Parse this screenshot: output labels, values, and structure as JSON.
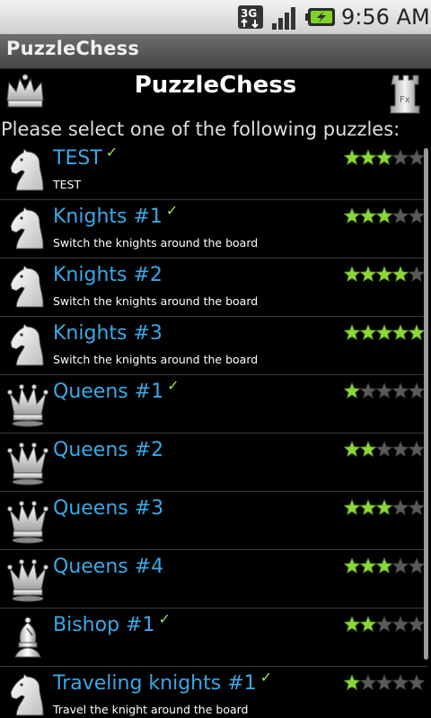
{
  "status_bar": {
    "time": "9:56 AM",
    "network": "3G"
  },
  "title_bar": {
    "title": "PuzzleChess"
  },
  "header": {
    "title": "PuzzleChess"
  },
  "prompt": "Please select one of the following puzzles:",
  "colors": {
    "link": "#3aa9e6",
    "star_on": "#8fd63a",
    "star_off": "#5a5a5a",
    "check": "#9fe05a"
  },
  "puzzles": [
    {
      "title": "TEST",
      "subtitle": "TEST",
      "stars": 3,
      "solved": true,
      "piece": "knight-icon"
    },
    {
      "title": "Knights #1",
      "subtitle": "Switch the knights around the board",
      "stars": 3,
      "solved": true,
      "piece": "knight-icon"
    },
    {
      "title": "Knights #2",
      "subtitle": "Switch the knights around the board",
      "stars": 4,
      "solved": false,
      "piece": "knight-icon"
    },
    {
      "title": "Knights #3",
      "subtitle": "Switch the knights around the board",
      "stars": 5,
      "solved": false,
      "piece": "knight-icon"
    },
    {
      "title": "Queens #1",
      "subtitle": "",
      "stars": 1,
      "solved": true,
      "piece": "queen-icon"
    },
    {
      "title": "Queens #2",
      "subtitle": "",
      "stars": 2,
      "solved": false,
      "piece": "queen-icon"
    },
    {
      "title": "Queens #3",
      "subtitle": "",
      "stars": 3,
      "solved": false,
      "piece": "queen-icon"
    },
    {
      "title": "Queens #4",
      "subtitle": "",
      "stars": 3,
      "solved": false,
      "piece": "queen-icon"
    },
    {
      "title": "Bishop #1",
      "subtitle": "",
      "stars": 2,
      "solved": true,
      "piece": "bishop-icon"
    },
    {
      "title": "Traveling knights #1",
      "subtitle": "Travel the knight around the board",
      "stars": 1,
      "solved": true,
      "piece": "knight-icon"
    }
  ],
  "check_mark": "✓"
}
